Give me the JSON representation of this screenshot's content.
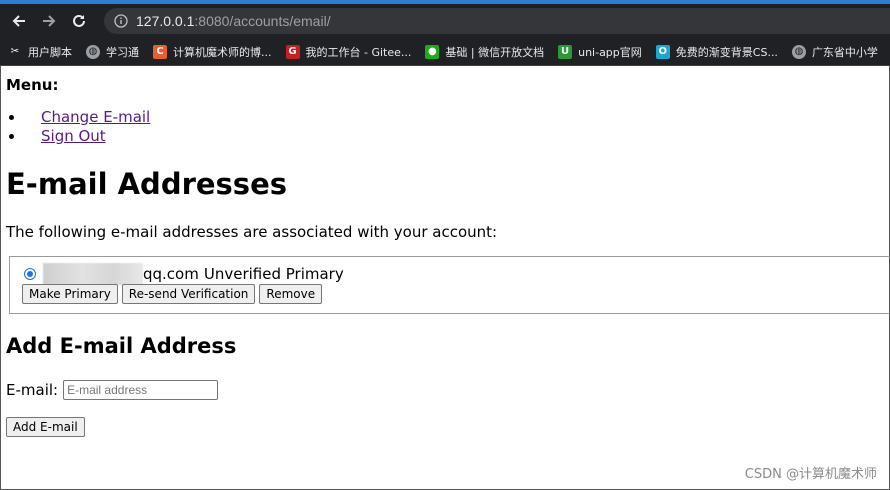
{
  "browser": {
    "url_host": "127.0.0.1",
    "url_rest": ":8080/accounts/email/",
    "bookmarks": [
      {
        "label": "用户脚本",
        "icon": "user-script-icon",
        "color": "#202124",
        "glyph": "✂"
      },
      {
        "label": "学习通",
        "icon": "globe-icon",
        "color": "#5f6368",
        "glyph": "◍"
      },
      {
        "label": "计算机魔术师的博...",
        "icon": "csdn-icon",
        "color": "#e65f2e",
        "glyph": "C"
      },
      {
        "label": "我的工作台 - Gitee...",
        "icon": "gitee-icon",
        "color": "#c71d23",
        "glyph": "G"
      },
      {
        "label": "基础 | 微信开放文档",
        "icon": "wechat-icon",
        "color": "#1aad19",
        "glyph": "●"
      },
      {
        "label": "uni-app官网",
        "icon": "uniapp-icon",
        "color": "#2b9939",
        "glyph": "U"
      },
      {
        "label": "免费的渐变背景CS...",
        "icon": "gradient-icon",
        "color": "#19a7d4",
        "glyph": "O"
      },
      {
        "label": "广东省中小学",
        "icon": "globe-icon",
        "color": "#5f6368",
        "glyph": "◍"
      }
    ]
  },
  "page": {
    "menu_title": "Menu:",
    "menu_items": [
      "Change E-mail",
      "Sign Out"
    ],
    "title": "E-mail Addresses",
    "intro": "The following e-mail addresses are associated with your account:",
    "email_entry": {
      "email_visible": "qq.com",
      "status": "Unverified Primary"
    },
    "buttons": {
      "make_primary": "Make Primary",
      "resend": "Re-send Verification",
      "remove": "Remove"
    },
    "add_title": "Add E-mail Address",
    "email_label": "E-mail:",
    "email_placeholder": "E-mail address",
    "add_button": "Add E-mail",
    "watermark": "CSDN @计算机魔术师"
  },
  "colors": {
    "link_visited": "#551a8b",
    "radio_accent": "#1a73e8",
    "chrome_dark": "#202124"
  }
}
